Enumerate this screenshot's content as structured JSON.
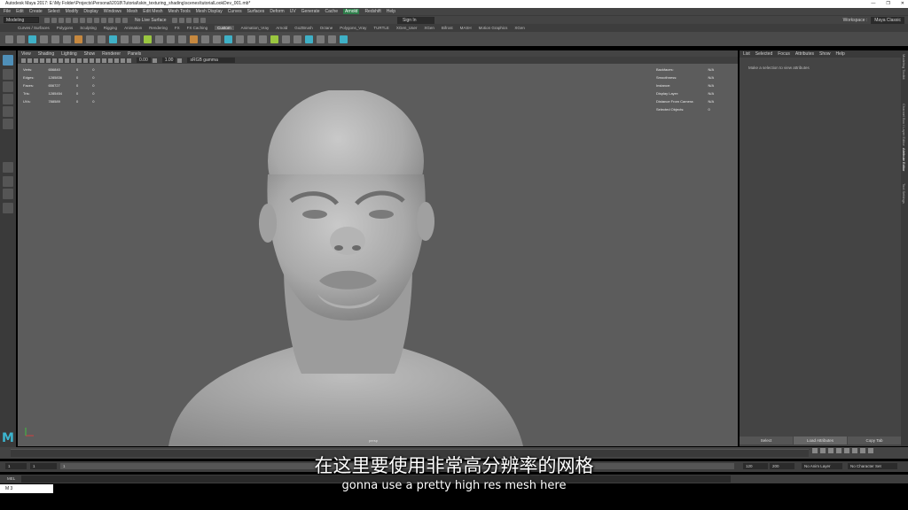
{
  "window": {
    "title": "Autodesk Maya 2017: E:\\My Folder\\Projects\\Personal\\2018\\Tutorial\\skin_texturing_shading\\scenes\\tutorialLookDev_001.mb*",
    "controls": [
      "—",
      "❐",
      "✕"
    ]
  },
  "menus": [
    "File",
    "Edit",
    "Create",
    "Select",
    "Modify",
    "Display",
    "Windows",
    "Mesh",
    "Edit Mesh",
    "Mesh Tools",
    "Mesh Display",
    "Curves",
    "Surfaces",
    "Deform",
    "UV",
    "Generate",
    "Cache",
    "Arnold",
    "Redshift",
    "Help"
  ],
  "status_line": {
    "mode": "Modeling",
    "live_surface": "No Live Surface",
    "sign_in": "Sign In",
    "workspace_label": "Workspace :",
    "workspace_value": "Maya Classic"
  },
  "shelf_tabs": [
    "Curves / Surfaces",
    "Polygons",
    "Sculpting",
    "Rigging",
    "Animation",
    "Rendering",
    "FX",
    "FX Caching",
    "Custom",
    "Animation_Vray",
    "Arnold",
    "GoZBrush",
    "Octane",
    "Polygons_Vray",
    "TURTLE",
    "XGen_User",
    "XGen",
    "Bifrost",
    "MASH",
    "Motion Graphics",
    "XGen"
  ],
  "shelf_active": "Custom",
  "viewport": {
    "menu": [
      "View",
      "Shading",
      "Lighting",
      "Show",
      "Renderer",
      "Panels"
    ],
    "field_a": "0.00",
    "field_b": "1.00",
    "color_space": "sRGB gamma",
    "hud_left": [
      {
        "label": "Verts:",
        "v1": "656840",
        "v2": "0",
        "v3": "0"
      },
      {
        "label": "Edges:",
        "v1": "1285836",
        "v2": "0",
        "v3": "0"
      },
      {
        "label": "Faces:",
        "v1": "656727",
        "v2": "0",
        "v3": "0"
      },
      {
        "label": "Tris:",
        "v1": "1285454",
        "v2": "0",
        "v3": "0"
      },
      {
        "label": "UVs:",
        "v1": "788589",
        "v2": "0",
        "v3": "0"
      }
    ],
    "hud_right": [
      {
        "label": "Backfaces:",
        "value": "N/A"
      },
      {
        "label": "Smoothness:",
        "value": "N/A"
      },
      {
        "label": "Instance:",
        "value": "N/A"
      },
      {
        "label": "Display Layer:",
        "value": "N/A"
      },
      {
        "label": "Distance From Camera:",
        "value": "N/A"
      },
      {
        "label": "Selected Objects:",
        "value": "0"
      }
    ],
    "camera": "persp"
  },
  "attribute_editor": {
    "tabs": [
      "List",
      "Selected",
      "Focus",
      "Attributes",
      "Show",
      "Help"
    ],
    "message": "Make a selection to view attributes",
    "buttons": [
      "Select",
      "Load Attributes",
      "Copy Tab"
    ]
  },
  "side_tabs": [
    "Modeling Toolkit",
    "Attribute Editor",
    "Tool Settings",
    "Channel Box / Layer Editor"
  ],
  "range": {
    "start": "1",
    "start2": "1",
    "current": "1",
    "end": "120",
    "end2": "200",
    "anim_layer": "No Anim Layer",
    "char_set": "No Character Set"
  },
  "command_line": {
    "label": "MEL"
  },
  "taskbar": {
    "label": "M 3"
  },
  "subtitles": {
    "chinese": "在这里要使用非常高分辨率的网格",
    "english": "gonna use a pretty high res mesh here"
  }
}
